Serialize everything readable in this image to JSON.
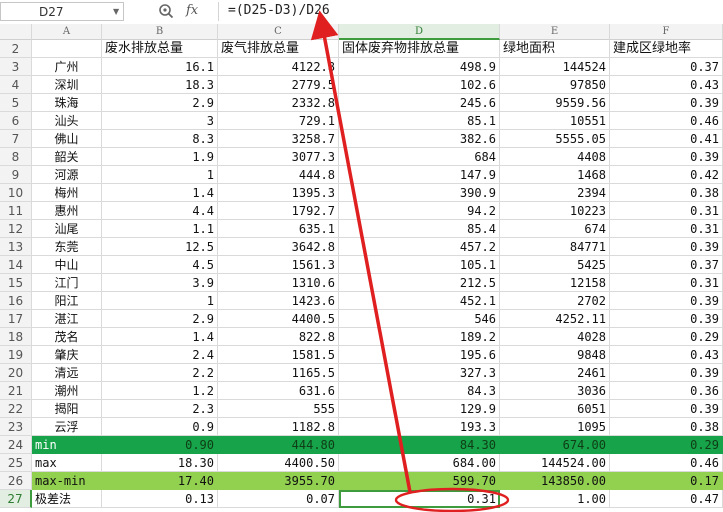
{
  "formula_bar": {
    "cell_ref": "D27",
    "formula": "=(D25-D3)/D26"
  },
  "columns": [
    "A",
    "B",
    "C",
    "D",
    "E",
    "F"
  ],
  "selected_column": "D",
  "selected_row": "27",
  "header_row": {
    "row_num": "2",
    "cells": [
      "",
      "废水排放总量",
      "废气排放总量",
      "固体废弃物排放总量",
      "绿地面积",
      "建成区绿地率"
    ]
  },
  "data_rows": [
    {
      "row_num": "3",
      "cells": [
        "广州",
        "16.1",
        "4122.8",
        "498.9",
        "144524",
        "0.37"
      ]
    },
    {
      "row_num": "4",
      "cells": [
        "深圳",
        "18.3",
        "2779.5",
        "102.6",
        "97850",
        "0.43"
      ]
    },
    {
      "row_num": "5",
      "cells": [
        "珠海",
        "2.9",
        "2332.8",
        "245.6",
        "9559.56",
        "0.39"
      ]
    },
    {
      "row_num": "6",
      "cells": [
        "汕头",
        "3",
        "729.1",
        "85.1",
        "10551",
        "0.46"
      ]
    },
    {
      "row_num": "7",
      "cells": [
        "佛山",
        "8.3",
        "3258.7",
        "382.6",
        "5555.05",
        "0.41"
      ]
    },
    {
      "row_num": "8",
      "cells": [
        "韶关",
        "1.9",
        "3077.3",
        "684",
        "4408",
        "0.39"
      ]
    },
    {
      "row_num": "9",
      "cells": [
        "河源",
        "1",
        "444.8",
        "147.9",
        "1468",
        "0.42"
      ]
    },
    {
      "row_num": "10",
      "cells": [
        "梅州",
        "1.4",
        "1395.3",
        "390.9",
        "2394",
        "0.38"
      ]
    },
    {
      "row_num": "11",
      "cells": [
        "惠州",
        "4.4",
        "1792.7",
        "94.2",
        "10223",
        "0.31"
      ]
    },
    {
      "row_num": "12",
      "cells": [
        "汕尾",
        "1.1",
        "635.1",
        "85.4",
        "674",
        "0.31"
      ]
    },
    {
      "row_num": "13",
      "cells": [
        "东莞",
        "12.5",
        "3642.8",
        "457.2",
        "84771",
        "0.39"
      ]
    },
    {
      "row_num": "14",
      "cells": [
        "中山",
        "4.5",
        "1561.3",
        "105.1",
        "5425",
        "0.37"
      ]
    },
    {
      "row_num": "15",
      "cells": [
        "江门",
        "3.9",
        "1310.6",
        "212.5",
        "12158",
        "0.31"
      ]
    },
    {
      "row_num": "16",
      "cells": [
        "阳江",
        "1",
        "1423.6",
        "452.1",
        "2702",
        "0.39"
      ]
    },
    {
      "row_num": "17",
      "cells": [
        "湛江",
        "2.9",
        "4400.5",
        "546",
        "4252.11",
        "0.39"
      ]
    },
    {
      "row_num": "18",
      "cells": [
        "茂名",
        "1.4",
        "822.8",
        "189.2",
        "4028",
        "0.29"
      ]
    },
    {
      "row_num": "19",
      "cells": [
        "肇庆",
        "2.4",
        "1581.5",
        "195.6",
        "9848",
        "0.43"
      ]
    },
    {
      "row_num": "20",
      "cells": [
        "清远",
        "2.2",
        "1165.5",
        "327.3",
        "2461",
        "0.39"
      ]
    },
    {
      "row_num": "21",
      "cells": [
        "潮州",
        "1.2",
        "631.6",
        "84.3",
        "3036",
        "0.36"
      ]
    },
    {
      "row_num": "22",
      "cells": [
        "揭阳",
        "2.3",
        "555",
        "129.9",
        "6051",
        "0.39"
      ]
    },
    {
      "row_num": "23",
      "cells": [
        "云浮",
        "0.9",
        "1182.8",
        "193.3",
        "1095",
        "0.38"
      ]
    },
    {
      "row_num": "24",
      "cells": [
        "min",
        "0.90",
        "444.80",
        "84.30",
        "674.00",
        "0.29"
      ]
    },
    {
      "row_num": "25",
      "cells": [
        "max",
        "18.30",
        "4400.50",
        "684.00",
        "144524.00",
        "0.46"
      ]
    },
    {
      "row_num": "26",
      "cells": [
        "max-min",
        "17.40",
        "3955.70",
        "599.70",
        "143850.00",
        "0.17"
      ]
    },
    {
      "row_num": "27",
      "cells": [
        "极差法",
        "0.13",
        "0.07",
        "0.31",
        "1.00",
        "0.47"
      ]
    }
  ],
  "annotation": {
    "arrow_color": "#e02020",
    "ellipse_color": "#e02020"
  }
}
